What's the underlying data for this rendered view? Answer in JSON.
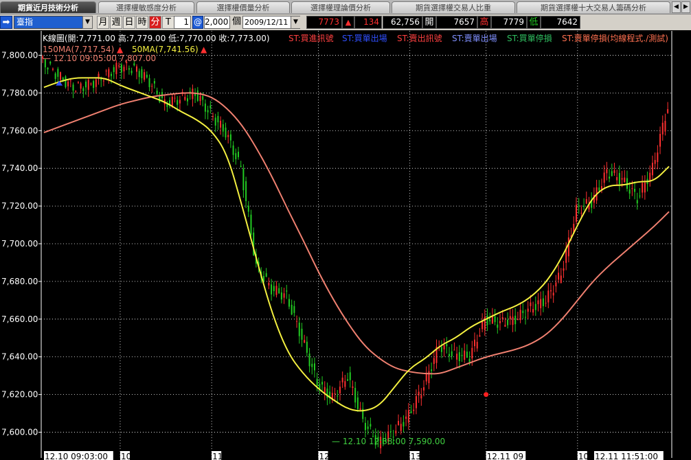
{
  "tabs": [
    {
      "label": "期貨近月技術分析",
      "active": true
    },
    {
      "label": "選擇權敏感度分析",
      "active": false
    },
    {
      "label": "選擇權價量分析",
      "active": false
    },
    {
      "label": "選擇權理論價分析",
      "active": false
    },
    {
      "label": "期貨選擇權交易人比重",
      "active": false
    },
    {
      "label": "期貨選擇權十大交易人籌碼分析",
      "active": false
    }
  ],
  "toolbar": {
    "go_icon": "arrow-right-icon",
    "symbol": "臺指",
    "periods": [
      {
        "label": "月",
        "active": false
      },
      {
        "label": "週",
        "active": false
      },
      {
        "label": "日",
        "active": false
      },
      {
        "label": "時",
        "active": false
      },
      {
        "label": "分",
        "active": true
      },
      {
        "label": "T",
        "active": false
      }
    ],
    "qty": "1",
    "at_symbol": "@",
    "lots": "2,000",
    "unit": "個",
    "date": "2009/12/11",
    "price": "7773",
    "change_arrow": "▲",
    "change": "134",
    "volume": "62,756",
    "open_label": "開",
    "open": "7657",
    "high_label": "高",
    "high": "7779",
    "low_label": "低",
    "low": "7642"
  },
  "legend": {
    "kbar": "K線圖(開:7,771.00 高:7,779.00 低:7,770.00 收:7,773.00)",
    "items": [
      {
        "label": "ST:買進訊號",
        "color": "#ff4040"
      },
      {
        "label": "ST:買單出場",
        "color": "#3050ff"
      },
      {
        "label": "ST:賣出訊號",
        "color": "#ff4040"
      },
      {
        "label": "ST:賣單出場",
        "color": "#8090ff"
      },
      {
        "label": "ST:買單停損",
        "color": "#30c060"
      },
      {
        "label": "ST:賣單停損(均線程式./測試)",
        "color": "#ff7050"
      }
    ],
    "ma150": "150MA(7,717.54)",
    "ma50": "50MA(7,741.56)",
    "arrow": "▲",
    "high_mark": "— 12.10 09:05:00  7,807.00",
    "low_mark": "— 12.10 12:38:00  7,590.00"
  },
  "colors": {
    "ma150": "#f08070",
    "ma50": "#f4f040",
    "up": "#ff3030",
    "down": "#22cc22",
    "grid": "#ffffff",
    "accent": "#1d5bd6"
  },
  "chart_data": {
    "type": "line",
    "title": "",
    "ylim": [
      7590,
      7810
    ],
    "yticks": [
      "7,800.00",
      "7,780.00",
      "7,760.00",
      "7,740.00",
      "7,720.00",
      "7,700.00",
      "7,680.00",
      "7,660.00",
      "7,640.00",
      "7,620.00",
      "7,600.00"
    ],
    "ytick_values": [
      7800,
      7780,
      7760,
      7740,
      7720,
      7700,
      7680,
      7660,
      7640,
      7620,
      7600
    ],
    "xticks": [
      "12.10 09:03:00",
      "10",
      "11",
      "12",
      "13",
      "12.11 09",
      "10",
      "12.11 11:51:00"
    ],
    "series": [
      {
        "name": "150MA",
        "values": [
          7759,
          7762,
          7765,
          7768,
          7771,
          7774,
          7776,
          7778,
          7779,
          7780,
          7780,
          7778,
          7772,
          7763,
          7750,
          7735,
          7718,
          7702,
          7685,
          7670,
          7657,
          7646,
          7639,
          7634,
          7632,
          7631,
          7631,
          7634,
          7637,
          7640,
          7642,
          7644,
          7647,
          7652,
          7660,
          7670,
          7680,
          7688,
          7695,
          7702,
          7709,
          7717
        ]
      },
      {
        "name": "50MA",
        "values": [
          7783,
          7786,
          7788,
          7788,
          7788,
          7784,
          7781,
          7778,
          7775,
          7770,
          7766,
          7760,
          7748,
          7720,
          7690,
          7662,
          7642,
          7631,
          7623,
          7617,
          7612,
          7611,
          7614,
          7624,
          7634,
          7639,
          7646,
          7650,
          7656,
          7660,
          7664,
          7667,
          7672,
          7680,
          7693,
          7710,
          7725,
          7731,
          7731,
          7733,
          7733,
          7741
        ]
      },
      {
        "name": "K線圖",
        "values": [
          7797,
          7789,
          7783,
          7784,
          7789,
          7794,
          7793,
          7786,
          7774,
          7777,
          7780,
          7769,
          7759,
          7740,
          7688,
          7676,
          7672,
          7650,
          7626,
          7618,
          7630,
          7606,
          7594,
          7600,
          7609,
          7625,
          7646,
          7641,
          7640,
          7660,
          7658,
          7660,
          7666,
          7670,
          7684,
          7718,
          7722,
          7738,
          7734,
          7724,
          7740,
          7773
        ]
      }
    ],
    "markers": [
      {
        "label": "buy",
        "x": 29,
        "y": 7620
      },
      {
        "label": "sell-exit",
        "x": 1,
        "y": 7785
      }
    ]
  }
}
